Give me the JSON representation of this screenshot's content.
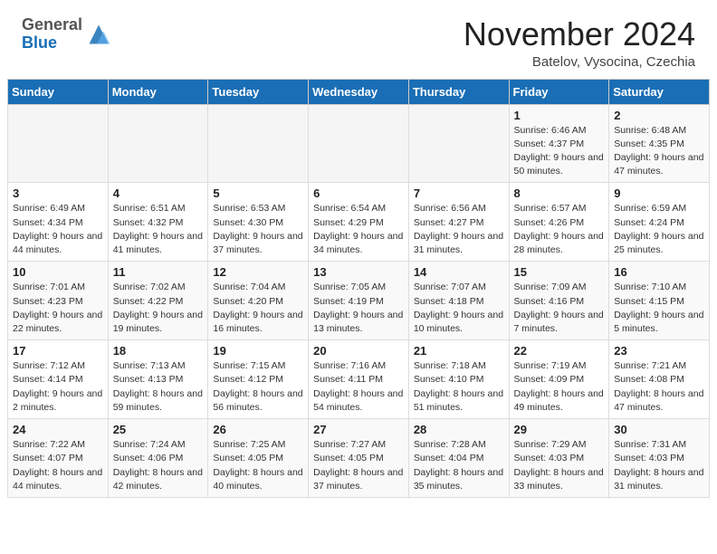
{
  "header": {
    "logo_general": "General",
    "logo_blue": "Blue",
    "month_title": "November 2024",
    "location": "Batelov, Vysocina, Czechia"
  },
  "days_of_week": [
    "Sunday",
    "Monday",
    "Tuesday",
    "Wednesday",
    "Thursday",
    "Friday",
    "Saturday"
  ],
  "weeks": [
    [
      {
        "day": "",
        "detail": ""
      },
      {
        "day": "",
        "detail": ""
      },
      {
        "day": "",
        "detail": ""
      },
      {
        "day": "",
        "detail": ""
      },
      {
        "day": "",
        "detail": ""
      },
      {
        "day": "1",
        "detail": "Sunrise: 6:46 AM\nSunset: 4:37 PM\nDaylight: 9 hours and 50 minutes."
      },
      {
        "day": "2",
        "detail": "Sunrise: 6:48 AM\nSunset: 4:35 PM\nDaylight: 9 hours and 47 minutes."
      }
    ],
    [
      {
        "day": "3",
        "detail": "Sunrise: 6:49 AM\nSunset: 4:34 PM\nDaylight: 9 hours and 44 minutes."
      },
      {
        "day": "4",
        "detail": "Sunrise: 6:51 AM\nSunset: 4:32 PM\nDaylight: 9 hours and 41 minutes."
      },
      {
        "day": "5",
        "detail": "Sunrise: 6:53 AM\nSunset: 4:30 PM\nDaylight: 9 hours and 37 minutes."
      },
      {
        "day": "6",
        "detail": "Sunrise: 6:54 AM\nSunset: 4:29 PM\nDaylight: 9 hours and 34 minutes."
      },
      {
        "day": "7",
        "detail": "Sunrise: 6:56 AM\nSunset: 4:27 PM\nDaylight: 9 hours and 31 minutes."
      },
      {
        "day": "8",
        "detail": "Sunrise: 6:57 AM\nSunset: 4:26 PM\nDaylight: 9 hours and 28 minutes."
      },
      {
        "day": "9",
        "detail": "Sunrise: 6:59 AM\nSunset: 4:24 PM\nDaylight: 9 hours and 25 minutes."
      }
    ],
    [
      {
        "day": "10",
        "detail": "Sunrise: 7:01 AM\nSunset: 4:23 PM\nDaylight: 9 hours and 22 minutes."
      },
      {
        "day": "11",
        "detail": "Sunrise: 7:02 AM\nSunset: 4:22 PM\nDaylight: 9 hours and 19 minutes."
      },
      {
        "day": "12",
        "detail": "Sunrise: 7:04 AM\nSunset: 4:20 PM\nDaylight: 9 hours and 16 minutes."
      },
      {
        "day": "13",
        "detail": "Sunrise: 7:05 AM\nSunset: 4:19 PM\nDaylight: 9 hours and 13 minutes."
      },
      {
        "day": "14",
        "detail": "Sunrise: 7:07 AM\nSunset: 4:18 PM\nDaylight: 9 hours and 10 minutes."
      },
      {
        "day": "15",
        "detail": "Sunrise: 7:09 AM\nSunset: 4:16 PM\nDaylight: 9 hours and 7 minutes."
      },
      {
        "day": "16",
        "detail": "Sunrise: 7:10 AM\nSunset: 4:15 PM\nDaylight: 9 hours and 5 minutes."
      }
    ],
    [
      {
        "day": "17",
        "detail": "Sunrise: 7:12 AM\nSunset: 4:14 PM\nDaylight: 9 hours and 2 minutes."
      },
      {
        "day": "18",
        "detail": "Sunrise: 7:13 AM\nSunset: 4:13 PM\nDaylight: 8 hours and 59 minutes."
      },
      {
        "day": "19",
        "detail": "Sunrise: 7:15 AM\nSunset: 4:12 PM\nDaylight: 8 hours and 56 minutes."
      },
      {
        "day": "20",
        "detail": "Sunrise: 7:16 AM\nSunset: 4:11 PM\nDaylight: 8 hours and 54 minutes."
      },
      {
        "day": "21",
        "detail": "Sunrise: 7:18 AM\nSunset: 4:10 PM\nDaylight: 8 hours and 51 minutes."
      },
      {
        "day": "22",
        "detail": "Sunrise: 7:19 AM\nSunset: 4:09 PM\nDaylight: 8 hours and 49 minutes."
      },
      {
        "day": "23",
        "detail": "Sunrise: 7:21 AM\nSunset: 4:08 PM\nDaylight: 8 hours and 47 minutes."
      }
    ],
    [
      {
        "day": "24",
        "detail": "Sunrise: 7:22 AM\nSunset: 4:07 PM\nDaylight: 8 hours and 44 minutes."
      },
      {
        "day": "25",
        "detail": "Sunrise: 7:24 AM\nSunset: 4:06 PM\nDaylight: 8 hours and 42 minutes."
      },
      {
        "day": "26",
        "detail": "Sunrise: 7:25 AM\nSunset: 4:05 PM\nDaylight: 8 hours and 40 minutes."
      },
      {
        "day": "27",
        "detail": "Sunrise: 7:27 AM\nSunset: 4:05 PM\nDaylight: 8 hours and 37 minutes."
      },
      {
        "day": "28",
        "detail": "Sunrise: 7:28 AM\nSunset: 4:04 PM\nDaylight: 8 hours and 35 minutes."
      },
      {
        "day": "29",
        "detail": "Sunrise: 7:29 AM\nSunset: 4:03 PM\nDaylight: 8 hours and 33 minutes."
      },
      {
        "day": "30",
        "detail": "Sunrise: 7:31 AM\nSunset: 4:03 PM\nDaylight: 8 hours and 31 minutes."
      }
    ]
  ]
}
